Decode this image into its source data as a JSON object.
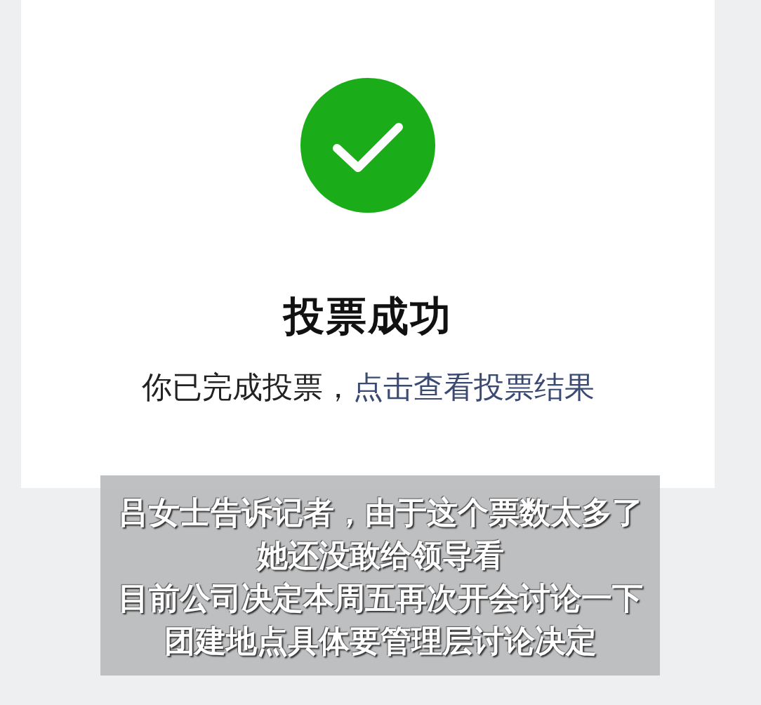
{
  "result": {
    "title": "投票成功",
    "message": "你已完成投票，",
    "link": "点击查看投票结果"
  },
  "caption": {
    "lines": [
      "吕女士告诉记者，由于这个票数太多了",
      "她还没敢给领导看",
      "目前公司决定本周五再次开会讨论一下",
      "团建地点具体要管理层讨论决定"
    ]
  }
}
